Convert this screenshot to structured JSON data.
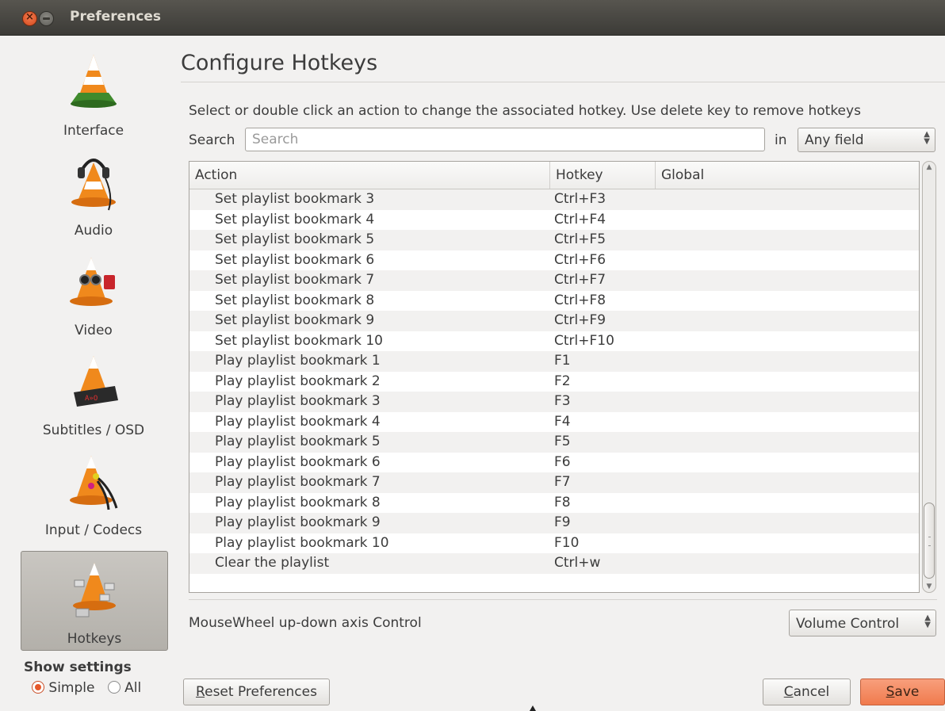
{
  "window": {
    "title": "Preferences"
  },
  "sidebar": {
    "items": [
      {
        "label": "Interface",
        "icon": "vlc-cone-interface-icon",
        "selected": false
      },
      {
        "label": "Audio",
        "icon": "vlc-cone-headphones-icon",
        "selected": false
      },
      {
        "label": "Video",
        "icon": "vlc-cone-glasses-icon",
        "selected": false
      },
      {
        "label": "Subtitles / OSD",
        "icon": "vlc-cone-subtitles-icon",
        "selected": false
      },
      {
        "label": "Input / Codecs",
        "icon": "vlc-cone-cables-icon",
        "selected": false
      },
      {
        "label": "Hotkeys",
        "icon": "vlc-cone-keys-icon",
        "selected": true
      }
    ],
    "show_settings_label": "Show settings",
    "radio_simple": "Simple",
    "radio_all": "All",
    "selected_mode": "Simple"
  },
  "main": {
    "heading": "Configure Hotkeys",
    "instructions": "Select or double click an action to change the associated hotkey. Use delete key to remove hotkeys",
    "search_label": "Search",
    "search_placeholder": "Search",
    "search_value": "",
    "in_label": "in",
    "field_select": "Any field",
    "table": {
      "headers": [
        "Action",
        "Hotkey",
        "Global"
      ],
      "rows": [
        {
          "action": "Set playlist bookmark 3",
          "hotkey": "Ctrl+F3",
          "global": ""
        },
        {
          "action": "Set playlist bookmark 4",
          "hotkey": "Ctrl+F4",
          "global": ""
        },
        {
          "action": "Set playlist bookmark 5",
          "hotkey": "Ctrl+F5",
          "global": ""
        },
        {
          "action": "Set playlist bookmark 6",
          "hotkey": "Ctrl+F6",
          "global": ""
        },
        {
          "action": "Set playlist bookmark 7",
          "hotkey": "Ctrl+F7",
          "global": ""
        },
        {
          "action": "Set playlist bookmark 8",
          "hotkey": "Ctrl+F8",
          "global": ""
        },
        {
          "action": "Set playlist bookmark 9",
          "hotkey": "Ctrl+F9",
          "global": ""
        },
        {
          "action": "Set playlist bookmark 10",
          "hotkey": "Ctrl+F10",
          "global": ""
        },
        {
          "action": "Play playlist bookmark 1",
          "hotkey": "F1",
          "global": ""
        },
        {
          "action": "Play playlist bookmark 2",
          "hotkey": "F2",
          "global": ""
        },
        {
          "action": "Play playlist bookmark 3",
          "hotkey": "F3",
          "global": ""
        },
        {
          "action": "Play playlist bookmark 4",
          "hotkey": "F4",
          "global": ""
        },
        {
          "action": "Play playlist bookmark 5",
          "hotkey": "F5",
          "global": ""
        },
        {
          "action": "Play playlist bookmark 6",
          "hotkey": "F6",
          "global": ""
        },
        {
          "action": "Play playlist bookmark 7",
          "hotkey": "F7",
          "global": ""
        },
        {
          "action": "Play playlist bookmark 8",
          "hotkey": "F8",
          "global": ""
        },
        {
          "action": "Play playlist bookmark 9",
          "hotkey": "F9",
          "global": ""
        },
        {
          "action": "Play playlist bookmark 10",
          "hotkey": "F10",
          "global": ""
        },
        {
          "action": "Clear the playlist",
          "hotkey": "Ctrl+w",
          "global": ""
        },
        {
          "action": "",
          "hotkey": "",
          "global": ""
        }
      ]
    },
    "mousewheel_label": "MouseWheel up-down axis Control",
    "mousewheel_select": "Volume Control"
  },
  "buttons": {
    "reset_first": "R",
    "reset_rest": "eset Preferences",
    "cancel_first": "C",
    "cancel_rest": "ancel",
    "save_first": "S",
    "save_rest": "ave"
  },
  "colors": {
    "accent": "#f07a4d",
    "titlebar": "#3c3b37",
    "window_bg": "#f2f1f0"
  }
}
